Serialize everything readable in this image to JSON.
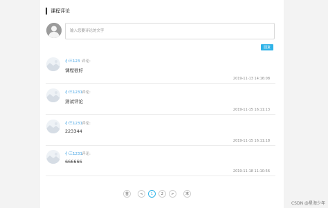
{
  "section": {
    "title": "课程评论"
  },
  "composer": {
    "placeholder": "输入您要评论的文字",
    "submit_label": "回复"
  },
  "comments": [
    {
      "author": "小三123",
      "tag": "评论:",
      "text": "课程很好",
      "time": "2019-11-13 14:16:08"
    },
    {
      "author": "小三1231",
      "tag": "评论:",
      "text": "测试评论",
      "time": "2019-11-15 16:11:13"
    },
    {
      "author": "小三1231",
      "tag": "评论:",
      "text": "223344",
      "time": "2019-11-15 16:11:18"
    },
    {
      "author": "小三1231",
      "tag": "评论:",
      "text": "666666",
      "time": "2019-11-18 11:10:56"
    }
  ],
  "pagination": {
    "first": "首",
    "prev": "<",
    "pages": [
      "1",
      "2"
    ],
    "current_page": "1",
    "next": ">",
    "last": "末"
  },
  "watermark": "CSDN @星海少年",
  "colors": {
    "accent": "#2fb3e8",
    "author": "#3c9fe3"
  }
}
